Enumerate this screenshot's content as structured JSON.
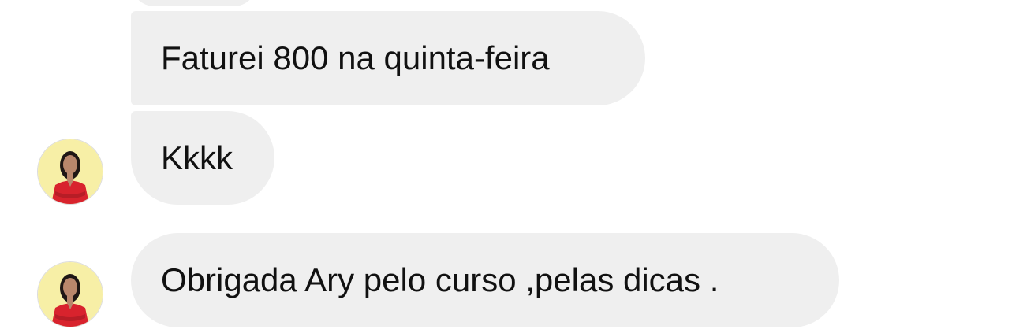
{
  "conversation": {
    "messages": [
      {
        "text": "Faturei 800 na quinta-feira",
        "show_avatar": false
      },
      {
        "text": "Kkkk",
        "show_avatar": true
      },
      {
        "text": "Obrigada Ary pelo curso ,pelas dicas .",
        "show_avatar": true
      }
    ]
  },
  "colors": {
    "background": "#ffffff",
    "bubble": "#efefef",
    "text": "#111111",
    "avatar_bg": "#f7efa6",
    "avatar_outfit": "#d8232d"
  },
  "icons": {
    "avatar": "profile-photo-woman-red-blazer"
  }
}
